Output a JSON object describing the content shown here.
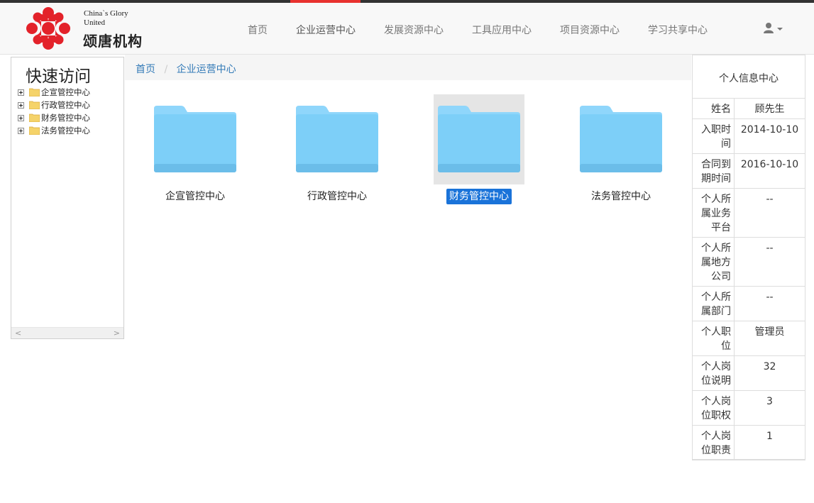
{
  "brand": {
    "en_name": "China`s Glory United",
    "cn_name": "颂唐机构"
  },
  "nav": {
    "items": [
      {
        "label": "首页"
      },
      {
        "label": "企业运营中心"
      },
      {
        "label": "发展资源中心"
      },
      {
        "label": "工具应用中心"
      },
      {
        "label": "项目资源中心"
      },
      {
        "label": "学习共享中心"
      }
    ],
    "active_index": 1,
    "user_menu_icon": "user-icon"
  },
  "quick_access": {
    "title": "快速访问",
    "items": [
      {
        "label": "企宣管控中心"
      },
      {
        "label": "行政管控中心"
      },
      {
        "label": "财务管控中心"
      },
      {
        "label": "法务管控中心"
      }
    ]
  },
  "breadcrumb": {
    "home": "首页",
    "current": "企业运营中心"
  },
  "folders": {
    "items": [
      {
        "label": "企宣管控中心"
      },
      {
        "label": "行政管控中心"
      },
      {
        "label": "财务管控中心"
      },
      {
        "label": "法务管控中心"
      }
    ],
    "selected_index": 2
  },
  "profile": {
    "title": "个人信息中心",
    "rows": [
      {
        "label": "姓名",
        "value": "顾先生"
      },
      {
        "label": "入职时间",
        "value": "2014-10-10"
      },
      {
        "label": "合同到期时间",
        "value": "2016-10-10"
      },
      {
        "label": "个人所属业务平台",
        "value": "--"
      },
      {
        "label": "个人所属地方公司",
        "value": "--"
      },
      {
        "label": "个人所属部门",
        "value": "--"
      },
      {
        "label": "个人职位",
        "value": "管理员"
      },
      {
        "label": "个人岗位说明",
        "value": "32"
      },
      {
        "label": "个人岗位职权",
        "value": "3"
      },
      {
        "label": "个人岗位职责",
        "value": "1"
      }
    ]
  },
  "colors": {
    "accent_red": "#e8322f",
    "link_blue": "#337ab7",
    "selection_blue": "#1a73d9",
    "folder_blue": "#7ccff8"
  }
}
